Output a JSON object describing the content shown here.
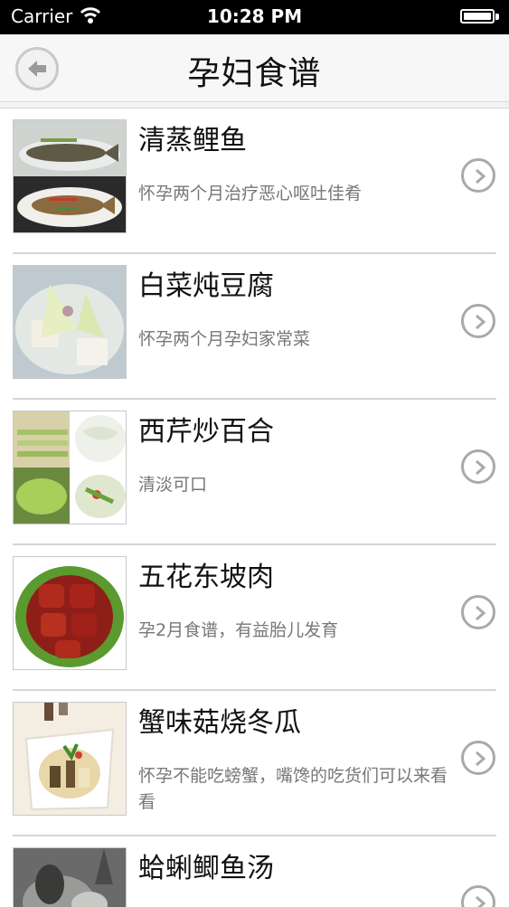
{
  "status": {
    "carrier": "Carrier",
    "time": "10:28 PM"
  },
  "nav": {
    "title": "孕妇食谱"
  },
  "recipes": [
    {
      "title": "清蒸鲤鱼",
      "desc": "怀孕两个月治疗恶心呕吐佳肴"
    },
    {
      "title": "白菜炖豆腐",
      "desc": "怀孕两个月孕妇家常菜"
    },
    {
      "title": "西芹炒百合",
      "desc": "清淡可口"
    },
    {
      "title": "五花东坡肉",
      "desc": "孕2月食谱，有益胎儿发育"
    },
    {
      "title": "蟹味菇烧冬瓜",
      "desc": "怀孕不能吃螃蟹，嘴馋的吃货们可以来看看"
    },
    {
      "title": "蛤蜊鲫鱼汤",
      "desc": ""
    }
  ]
}
